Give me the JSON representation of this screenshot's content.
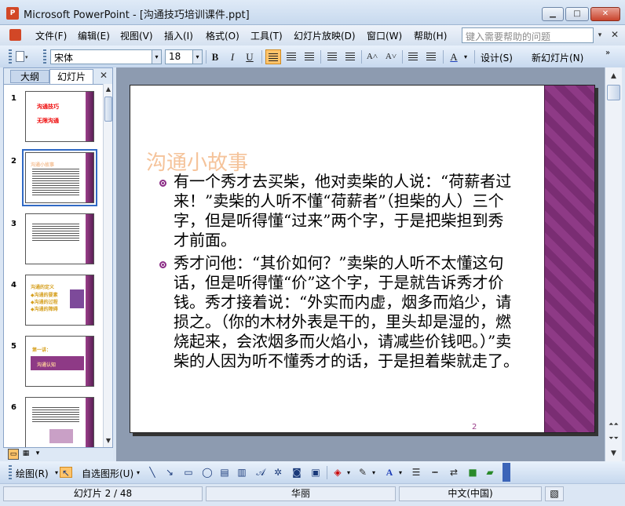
{
  "window": {
    "title": "Microsoft PowerPoint - [沟通技巧培训课件.ppt]",
    "app_icon": "P",
    "min_glyph": "▁",
    "max_glyph": "□",
    "close_glyph": "✕"
  },
  "menu": {
    "items": [
      "文件(F)",
      "编辑(E)",
      "视图(V)",
      "插入(I)",
      "格式(O)",
      "工具(T)",
      "幻灯片放映(D)",
      "窗口(W)",
      "帮助(H)"
    ],
    "help_placeholder": "键入需要帮助的问题",
    "dropdown_glyph": "▾",
    "close_glyph": "✕"
  },
  "format_toolbar": {
    "font_name": "宋体",
    "font_size": "18",
    "bold": "B",
    "italic": "I",
    "underline": "U",
    "increase_font": "A˄",
    "decrease_font": "A˅",
    "font_color": "A",
    "design_label": "设计(S)",
    "new_slide_label": "新幻灯片(N)",
    "dropdown_glyph": "▾",
    "more_glyph": "»"
  },
  "left_pane": {
    "tabs": [
      "大纲",
      "幻灯片"
    ],
    "close_glyph": "✕",
    "thumbnails": [
      {
        "num": "1",
        "lines": [
          "沟通技巧",
          "无限沟通"
        ]
      },
      {
        "num": "2",
        "lines": [
          "沟通小故事"
        ]
      },
      {
        "num": "3",
        "lines": []
      },
      {
        "num": "4",
        "lines": [
          "沟通的定义",
          "◆沟通的要素",
          "◆沟通的过程",
          "◆沟通的障碍"
        ]
      },
      {
        "num": "5",
        "lines": [
          "第一讲：",
          "沟通认知"
        ]
      },
      {
        "num": "6",
        "lines": []
      }
    ],
    "scroll_up": "▲",
    "scroll_down": "▼"
  },
  "slide": {
    "title": "沟通小故事",
    "paragraphs": [
      "有一个秀才去买柴，他对卖柴的人说：“荷薪者过来！”卖柴的人听不懂“荷薪者”（担柴的人）三个字，但是听得懂“过来”两个字，于是把柴担到秀才前面。",
      "秀才问他：“其价如何？”卖柴的人听不太懂这句话，但是听得懂“价”这个字，于是就告诉秀才价钱。秀才接着说：“外实而内虚，烟多而焰少，请损之。（你的木材外表是干的，里头却是湿的，燃烧起来，会浓烟多而火焰小，请减些价钱吧。）”卖柴的人因为听不懂秀才的话，于是担着柴就走了。"
    ],
    "page_number": "2",
    "accent_color": "#7a2d73",
    "bullet_color": "#8b2c86",
    "title_color": "#f5c39a"
  },
  "scrollbar": {
    "up": "▲",
    "down": "▼",
    "prev_slide": "⏶⏶",
    "next_slide": "⏷⏷"
  },
  "draw_toolbar": {
    "draw_label": "绘图(R)",
    "autoshape_label": "自选图形(U)",
    "dropdown_glyph": "▾"
  },
  "status": {
    "slide_position": "幻灯片 2 / 48",
    "design": "华丽",
    "language": "中文(中国)"
  },
  "icons": {
    "new": "new-document-icon",
    "align_left": "align-left-icon",
    "center": "align-center-icon",
    "align_right": "align-right-icon",
    "view_normal": "normal-view-icon",
    "view_sorter": "slide-sorter-icon",
    "view_show": "slideshow-icon"
  }
}
